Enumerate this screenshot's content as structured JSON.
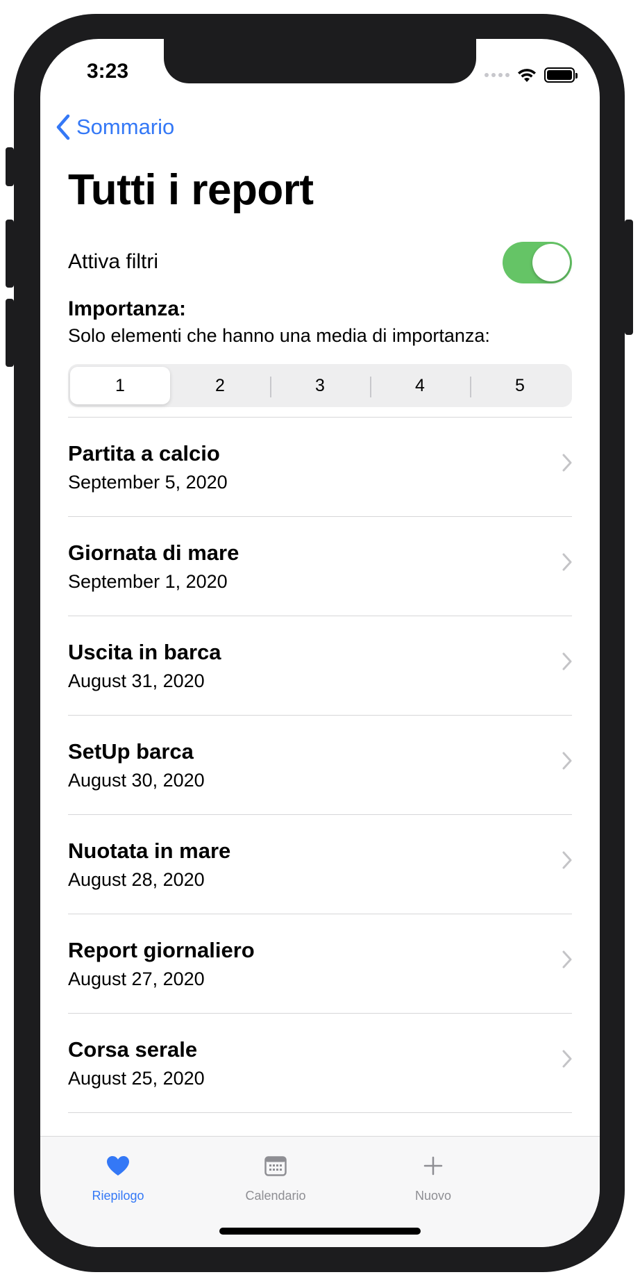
{
  "status_bar": {
    "time": "3:23"
  },
  "nav": {
    "back_label": "Sommario",
    "title": "Tutti i report"
  },
  "filter": {
    "toggle_label": "Attiva filtri",
    "enabled": true
  },
  "importance": {
    "heading": "Importanza:",
    "description": "Solo elementi che hanno una media di importanza:",
    "segments": [
      "1",
      "2",
      "3",
      "4",
      "5"
    ],
    "selected": "1"
  },
  "reports": [
    {
      "title": "Partita a calcio",
      "date": "September 5, 2020"
    },
    {
      "title": "Giornata di mare",
      "date": "September 1, 2020"
    },
    {
      "title": "Uscita in barca",
      "date": "August 31, 2020"
    },
    {
      "title": "SetUp barca",
      "date": "August 30, 2020"
    },
    {
      "title": "Nuotata in mare",
      "date": "August 28, 2020"
    },
    {
      "title": "Report giornaliero",
      "date": "August 27, 2020"
    },
    {
      "title": "Corsa serale",
      "date": "August 25, 2020"
    }
  ],
  "tabbar": {
    "items": [
      {
        "label": "Riepilogo",
        "icon": "heart-icon",
        "active": true
      },
      {
        "label": "Calendario",
        "icon": "calendar-icon",
        "active": false
      },
      {
        "label": "Nuovo",
        "icon": "plus-icon",
        "active": false
      }
    ]
  },
  "colors": {
    "accent": "#3478f6",
    "toggle_on": "#65c466",
    "inactive_tab": "#8e8e93",
    "chevron": "#c4c4c7"
  }
}
